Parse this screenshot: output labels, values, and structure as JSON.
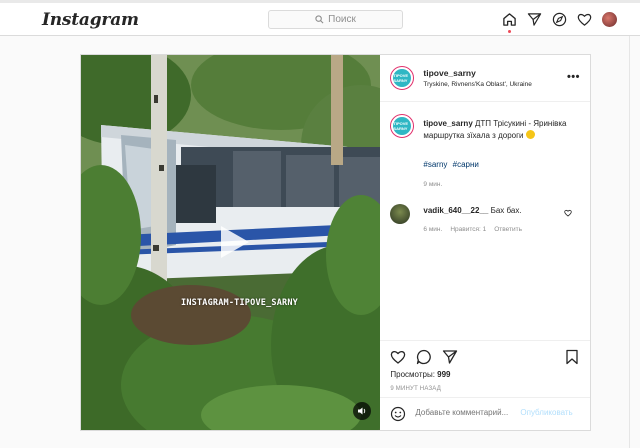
{
  "header": {
    "logo": "Instagram",
    "search_placeholder": "Поиск"
  },
  "post": {
    "username": "tipove_sarny",
    "location": "Tryskine, Rivnens'Ka Oblast', Ukraine",
    "avatar_text": "TIPOVE SARNY",
    "watermark": "INSTAGRAM-TIPOVE_SARNY",
    "caption_user": "tipove_sarny",
    "caption_text": "ДТП Трісукині - Яринівка маршрутка зїхала з дороги",
    "hashtags": [
      "#sarny",
      "#сарни"
    ],
    "caption_time": "9 мин.",
    "comment": {
      "user": "vadik_640__22__",
      "text": "Бах бах.",
      "time": "6 мин.",
      "likes": "Нравится: 1",
      "reply": "Ответить"
    },
    "views_label": "Просмотры:",
    "views_count": "999",
    "posted": "9 МИНУТ НАЗАД",
    "add_comment_placeholder": "Добавьте комментарий...",
    "publish_label": "Опубликовать"
  },
  "colors": {
    "accent_link": "#00376b",
    "publish_disabled": "#b2dffc",
    "notification_dot": "#ed4956"
  }
}
